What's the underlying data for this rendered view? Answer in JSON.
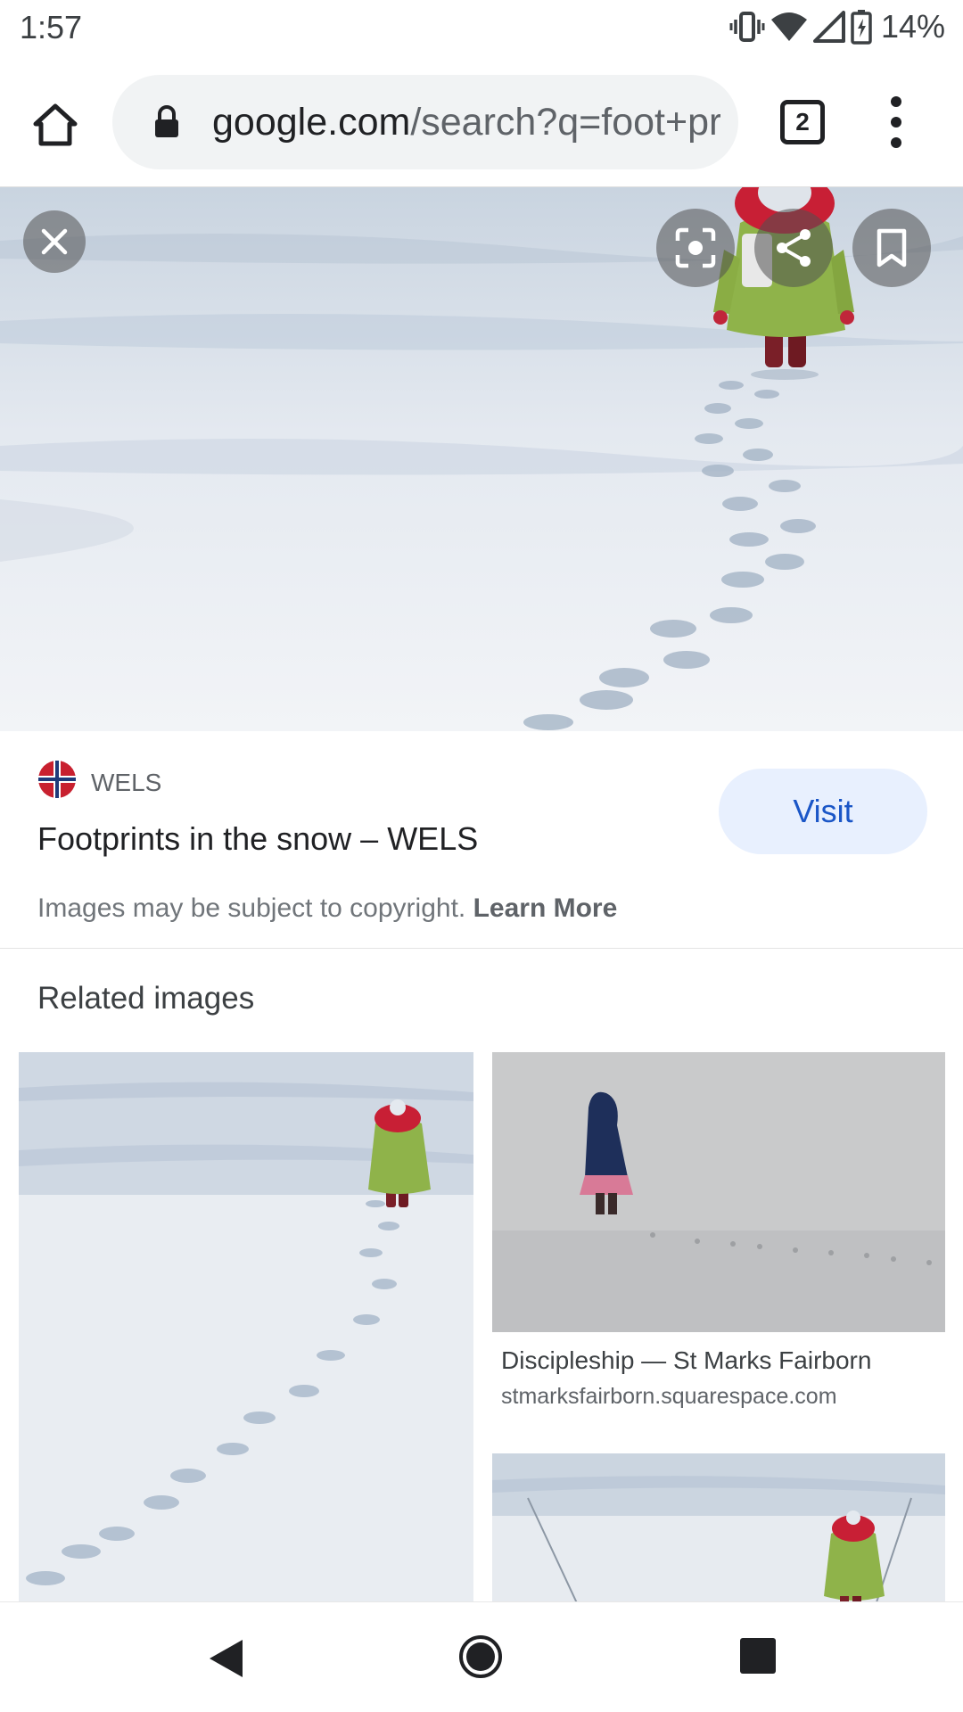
{
  "status_bar": {
    "time": "1:57",
    "battery": "14%",
    "icons": [
      "vibrate-icon",
      "wifi-icon",
      "signal-icon",
      "battery-charging-icon"
    ]
  },
  "browser": {
    "url_host": "google.com",
    "url_path": "/search?q=foot+pr",
    "tab_count": "2",
    "icons": [
      "home-icon",
      "lock-icon",
      "more-vert-icon"
    ]
  },
  "viewer": {
    "icons": [
      "close-icon",
      "lens-icon",
      "share-icon",
      "bookmark-icon"
    ],
    "source_name": "WELS",
    "title": "Footprints in the snow – WELS",
    "visit_label": "Visit",
    "copyright_text": "Images may be subject to copyright.",
    "learn_more_label": "Learn More",
    "accent_color": "#1a56c7"
  },
  "related": {
    "heading": "Related images",
    "items": [
      {
        "title": "",
        "site": ""
      },
      {
        "title": "Discipleship — St Marks Fairborn",
        "site": "stmarksfairborn.squarespace.com"
      },
      {
        "title": "",
        "site": ""
      }
    ]
  },
  "nav_bar": {
    "icons": [
      "back-icon",
      "home-circle-icon",
      "recents-icon"
    ]
  }
}
